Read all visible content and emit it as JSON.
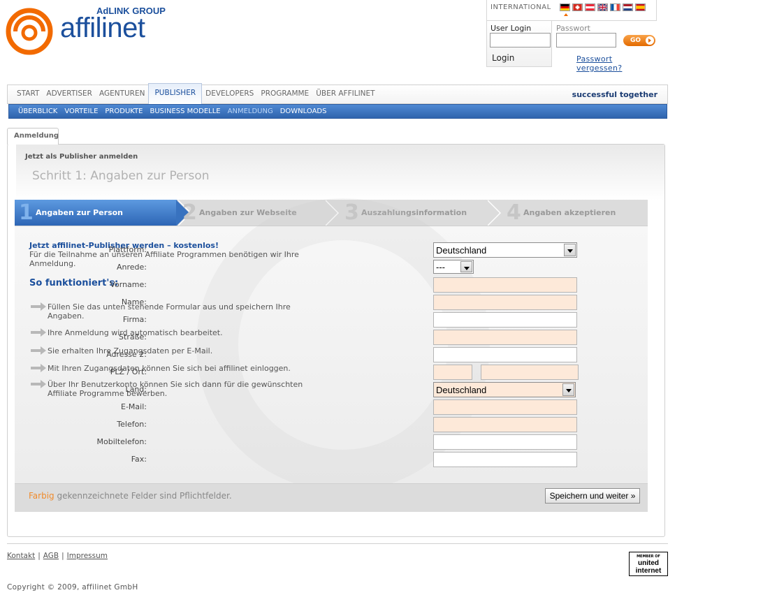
{
  "brand": {
    "group": "AdLINK GROUP",
    "name": "affilinet",
    "colors": {
      "primary_blue": "#1b4f9c",
      "orange": "#f26a00",
      "required_field": "#fde9d9"
    }
  },
  "header": {
    "international_label": "INTERNATIONAL",
    "flags": [
      "flag-de-icon",
      "flag-ch-icon",
      "flag-at-icon",
      "flag-uk-icon",
      "flag-fr-icon",
      "flag-nl-icon",
      "flag-es-icon"
    ],
    "login": {
      "user_label": "User Login",
      "password_label": "Passwort",
      "go_label": "GO",
      "login_tab": "Login",
      "forgot_link": "Passwort vergessen?"
    }
  },
  "nav": {
    "items": [
      "START",
      "ADVERTISER",
      "AGENTUREN",
      "PUBLISHER",
      "DEVELOPERS",
      "PROGRAMME",
      "ÜBER AFFILINET"
    ],
    "active": "PUBLISHER",
    "slogan": "successful together",
    "sub_items": [
      "ÜBERBLICK",
      "VORTEILE",
      "PRODUKTE",
      "BUSINESS MODELLE",
      "ANMELDUNG",
      "DOWNLOADS"
    ],
    "sub_active": "ANMELDUNG"
  },
  "page": {
    "tab": "Anmeldung",
    "subtitle": "Jetzt als Publisher anmelden",
    "title": "Schritt 1: Angaben zur Person"
  },
  "steps": [
    {
      "num": "1",
      "label": "Angaben zur Person"
    },
    {
      "num": "2",
      "label": "Angaben zur Webseite"
    },
    {
      "num": "3",
      "label": "Auszahlungsinformation"
    },
    {
      "num": "4",
      "label": "Angaben akzeptieren"
    }
  ],
  "intro": {
    "heading": "Jetzt affilinet-Publisher werden – kostenlos!",
    "text": "Für die Teilnahme an unseren Affiliate Programmen benötigen wir Ihre Anmeldung.",
    "how_heading": "So funktioniert's:",
    "how_items": [
      "Füllen Sie das unten stehende Formular aus und speichern Ihre Angaben.",
      "Ihre Anmeldung wird automatisch bearbeitet.",
      "Sie erhalten Ihre Zugangsdaten per E-Mail.",
      "Mit Ihren Zugangsdaten können Sie sich bei affilinet einloggen.",
      "Über Ihr Benutzerkonto können Sie sich dann für die gewünschten Affiliate Programme bewerben."
    ]
  },
  "form": {
    "plattform_label": "Plattform:",
    "plattform_value": "Deutschland",
    "anrede_label": "Anrede:",
    "anrede_value": "---",
    "vorname_label": "Vorname:",
    "name_label": "Name:",
    "firma_label": "Firma:",
    "strasse_label": "Straße:",
    "adresse2_label": "Adresse 2:",
    "plz_ort_label": "PLZ /  Ort:",
    "land_label": "Land:",
    "land_value": "Deutschland",
    "email_label": "E-Mail:",
    "telefon_label": "Telefon:",
    "mobil_label": "Mobiltelefon:",
    "fax_label": "Fax:"
  },
  "form_footer": {
    "required_accent": "Farbig",
    "required_rest": " gekennzeichnete Felder sind Pflichtfelder.",
    "save_button": "Speichern und weiter »"
  },
  "footer": {
    "links": [
      "Kontakt",
      "AGB",
      "Impressum"
    ],
    "copyright": "Copyright © 2009, affilinet GmbH",
    "badge_top": "MEMBER OF",
    "badge_line1": "united",
    "badge_line2": "internet"
  }
}
